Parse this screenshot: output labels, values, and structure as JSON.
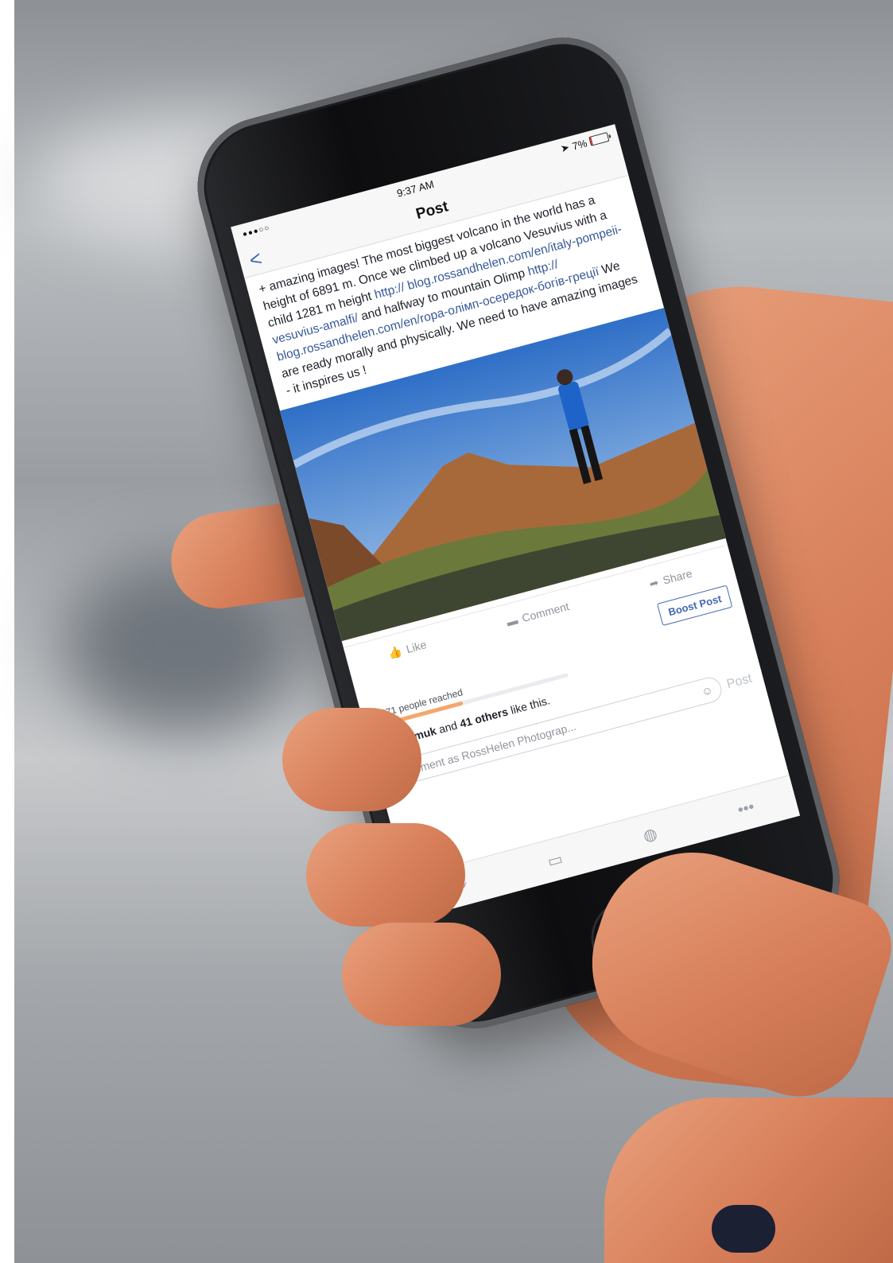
{
  "status": {
    "time": "9:37 AM",
    "battery": "7%",
    "battery_level": 0.07
  },
  "nav": {
    "title": "Post",
    "back_label": "<"
  },
  "post": {
    "text_parts": [
      {
        "t": "+ amazing images! The most biggest volcano in the world has a height of 6891 m. Once we climbed up a volcano Vesuvius with a child 1281 m height ",
        "link": false
      },
      {
        "t": "http:// blog.rossandhelen.com/en/italy-pompeii-vesuvius-amalfi/",
        "link": true
      },
      {
        "t": " and halfway to mountain Olimp ",
        "link": false
      },
      {
        "t": "http:// blog.rossandhelen.com/en/ropa-oлiмп-осередок-богiв-греції",
        "link": true
      },
      {
        "t": " We are ready morally and physically. We need to have amazing images - it inspires us !",
        "link": false
      }
    ]
  },
  "actions": {
    "like": "Like",
    "comment": "Comment",
    "share": "Share",
    "boost": "Boost Post"
  },
  "reach": {
    "text": "1 571 people reached",
    "fraction": 0.45
  },
  "likes": {
    "name": "a Mylymuk",
    "middle": " and ",
    "others": "41 others",
    "suffix": " like this."
  },
  "comment": {
    "placeholder": "Comment as RossHelen Photograp...",
    "post_label": "Post"
  },
  "tabbar": {
    "icons": [
      "activity-icon",
      "messages-icon",
      "globe-icon",
      "more-icon"
    ],
    "more_label": "•••"
  },
  "colors": {
    "accent": "#4267b2",
    "link": "#365899",
    "reach_bar": "#f5a66c"
  }
}
